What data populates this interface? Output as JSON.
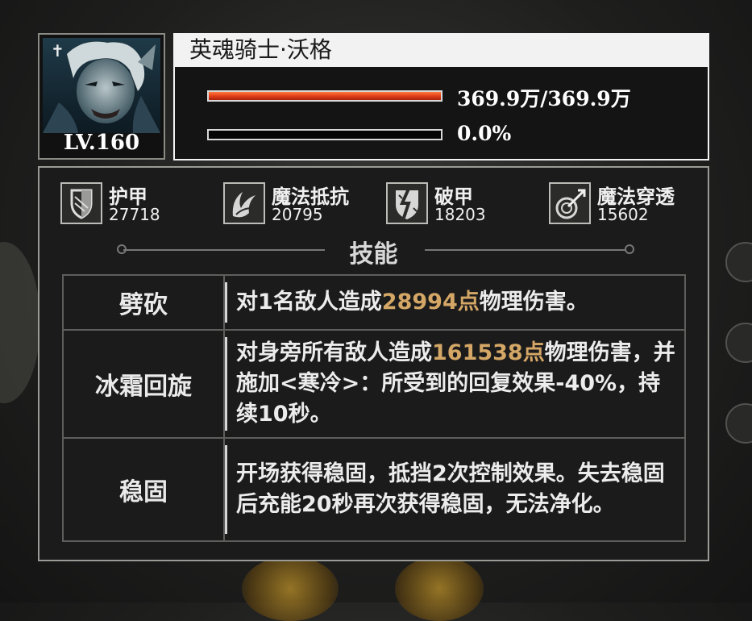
{
  "unit": {
    "name": "英魂骑士·沃格",
    "level": "LV.160",
    "rank_glyph": "✝",
    "portrait": "armored-undead-knight-portrait"
  },
  "bars": {
    "hp": {
      "text": "369.9万/369.9万",
      "fill_fraction": 1.0,
      "color": "#e2401a"
    },
    "energy": {
      "text": "0.0%",
      "fill_fraction": 0.0
    }
  },
  "stats": [
    {
      "icon": "armor-shield-icon",
      "name": "护甲",
      "value": "27718"
    },
    {
      "icon": "magic-resist-icon",
      "name": "魔法抵抗",
      "value": "20795"
    },
    {
      "icon": "armor-break-icon",
      "name": "破甲",
      "value": "18203"
    },
    {
      "icon": "magic-penetration-icon",
      "name": "魔法穿透",
      "value": "15602"
    }
  ],
  "section_title": "技能",
  "skills": [
    {
      "name": "劈砍",
      "desc_pre": "对1名敌人造成",
      "highlight": "28994点",
      "desc_post": "物理伤害。"
    },
    {
      "name": "冰霜回旋",
      "desc_pre": "对身旁所有敌人造成",
      "highlight": "161538点",
      "desc_post": "物理伤害，并施加<寒冷>：所受到的回复效果-40%，持续10秒。"
    },
    {
      "name": "稳固",
      "desc_pre": "开场获得稳固，抵挡2次控制效果。失去稳固后充能20秒再次获得稳固，无法净化。",
      "highlight": "",
      "desc_post": ""
    }
  ],
  "colors": {
    "highlight": "#d4a766",
    "hp_bar": "#e2401a",
    "panel_border": "#9a9a96"
  }
}
